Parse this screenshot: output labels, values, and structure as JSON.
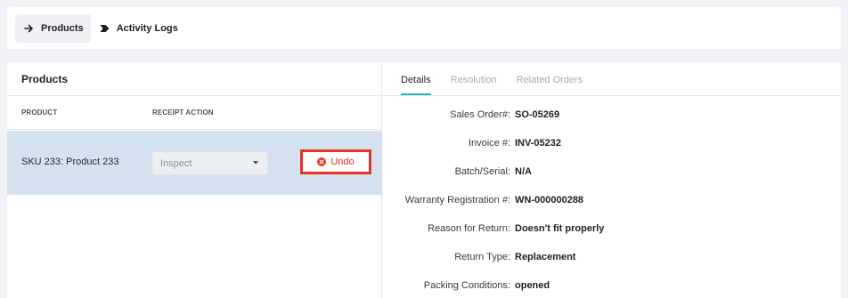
{
  "top_nav": {
    "tabs": [
      {
        "label": "Products",
        "active": true,
        "icon": "arrow-right-icon"
      },
      {
        "label": "Activity Logs",
        "active": false,
        "icon": "chevron-tag-icon"
      }
    ]
  },
  "products_panel": {
    "title": "Products",
    "columns": {
      "product": "PRODUCT",
      "receipt_action": "RECEIPT ACTION"
    },
    "row": {
      "product": "SKU 233: Product 233",
      "receipt_action": "Inspect",
      "undo_label": "Undo"
    }
  },
  "details_panel": {
    "tabs": [
      {
        "label": "Details",
        "active": true
      },
      {
        "label": "Resolution",
        "active": false
      },
      {
        "label": "Related Orders",
        "active": false
      }
    ],
    "fields": [
      {
        "label": "Sales Order#:",
        "value": "SO-05269"
      },
      {
        "label": "Invoice #:",
        "value": "INV-05232"
      },
      {
        "label": "Batch/Serial:",
        "value": "N/A"
      },
      {
        "label": "Warranty Registration #:",
        "value": "WN-000000288"
      },
      {
        "label": "Reason for Return:",
        "value": "Doesn't fit properly"
      },
      {
        "label": "Return Type:",
        "value": "Replacement"
      },
      {
        "label": "Packing Conditions:",
        "value": "opened"
      }
    ]
  },
  "colors": {
    "accent": "#21b8a8",
    "selected_row": "#d4e2f0",
    "danger": "#e8321f"
  }
}
